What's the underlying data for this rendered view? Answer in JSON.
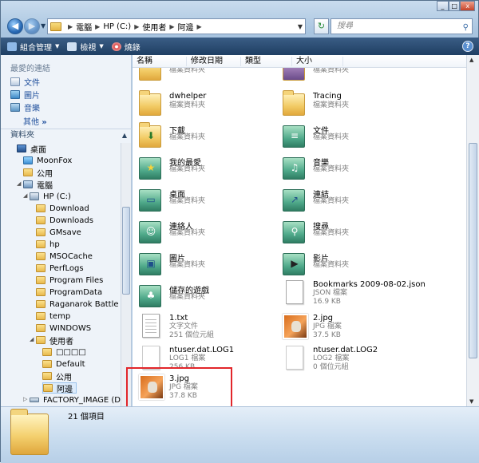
{
  "addressbar": {
    "crumbs": [
      "電腦",
      "HP (C:)",
      "使用者",
      "阿邊"
    ],
    "search_placeholder": "搜尋"
  },
  "toolbar": {
    "organize": "組合管理",
    "views": "檢視",
    "burn": "燒錄"
  },
  "favorites": {
    "title": "最愛的連結",
    "items": [
      "文件",
      "圖片",
      "音樂"
    ],
    "more": "其他",
    "more_arrows": "»"
  },
  "folders_title": "資料夾",
  "tree": {
    "desktop": "桌面",
    "moonfox": "MoonFox",
    "public": "公用",
    "computer": "電腦",
    "hpc": "HP (C:)",
    "subfolders": [
      "Download",
      "Downloads",
      "GMsave",
      "hp",
      "MSOCache",
      "PerfLogs",
      "Program Files",
      "ProgramData",
      "Raganarok Battle Offline",
      "temp",
      "WINDOWS",
      "使用者"
    ],
    "users": [
      "□□□□",
      "Default",
      "公用",
      "阿邊"
    ],
    "factory": "FACTORY_IMAGE (D:)"
  },
  "columns": [
    "名稱",
    "修改日期",
    "類型",
    "大小"
  ],
  "items": [
    {
      "name": "",
      "sub": "檔案資料夾"
    },
    {
      "name": "",
      "sub": "檔案資料夾"
    },
    {
      "name": "dwhelper",
      "sub": "檔案資料夾"
    },
    {
      "name": "Tracing",
      "sub": "檔案資料夾"
    },
    {
      "name": "下載",
      "sub": "檔案資料夾"
    },
    {
      "name": "文件",
      "sub": "檔案資料夾"
    },
    {
      "name": "我的最愛",
      "sub": "檔案資料夾"
    },
    {
      "name": "音樂",
      "sub": "檔案資料夾"
    },
    {
      "name": "桌面",
      "sub": "檔案資料夾"
    },
    {
      "name": "連結",
      "sub": "檔案資料夾"
    },
    {
      "name": "連絡人",
      "sub": "檔案資料夾"
    },
    {
      "name": "搜尋",
      "sub": "檔案資料夾"
    },
    {
      "name": "圖片",
      "sub": "檔案資料夾"
    },
    {
      "name": "影片",
      "sub": "檔案資料夾"
    },
    {
      "name": "儲存的遊戲",
      "sub": "檔案資料夾"
    },
    {
      "name": "Bookmarks 2009-08-02.json",
      "sub": "JSON 檔案",
      "size": "16.9 KB"
    },
    {
      "name": "1.txt",
      "sub": "文字文件",
      "size": "251 個位元組"
    },
    {
      "name": "2.jpg",
      "sub": "JPG 檔案",
      "size": "37.5 KB"
    },
    {
      "name": "ntuser.dat.LOG1",
      "sub": "LOG1 檔案",
      "size": "256 KB"
    },
    {
      "name": "ntuser.dat.LOG2",
      "sub": "LOG2 檔案",
      "size": "0 個位元組"
    },
    {
      "name": "3.jpg",
      "sub": "JPG 檔案",
      "size": "37.8 KB"
    }
  ],
  "details": {
    "count": "21 個項目"
  }
}
